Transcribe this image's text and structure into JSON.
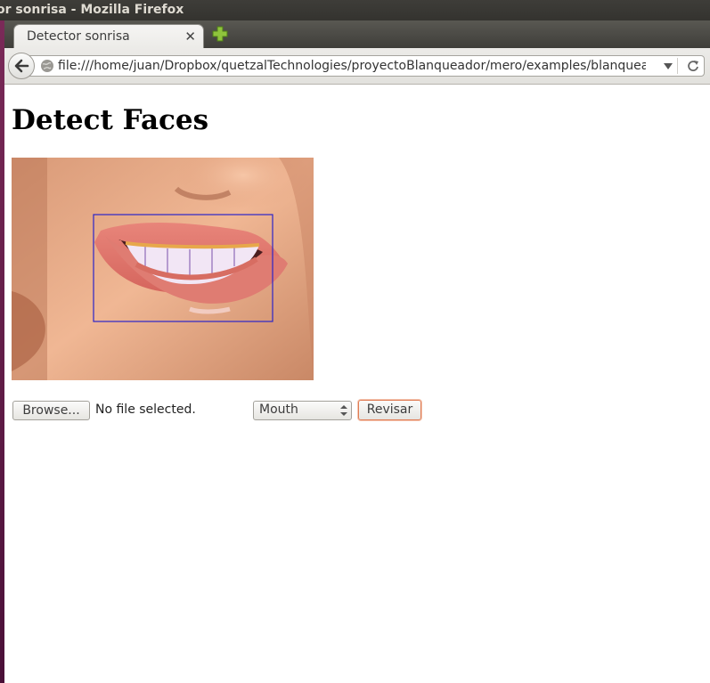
{
  "window": {
    "title": "or sonrisa - Mozilla Firefox"
  },
  "tabs": [
    {
      "label": "Detector sonrisa",
      "close_icon": "close-icon"
    }
  ],
  "toolbar": {
    "url": "file:///home/juan/Dropbox/quetzalTechnologies/proyectoBlanqueador/mero/examples/blanqueador"
  },
  "page": {
    "heading": "Detect Faces",
    "image_alt": "smiling mouth with detection rectangle",
    "detection_box_color": "#2b24c9",
    "form": {
      "browse_label": "Browse...",
      "file_status": "No file selected.",
      "select_value": "Mouth",
      "submit_label": "Revisar"
    }
  },
  "colors": {
    "accent_button_border": "#e07b53",
    "titlebar": "#3e3d39"
  }
}
